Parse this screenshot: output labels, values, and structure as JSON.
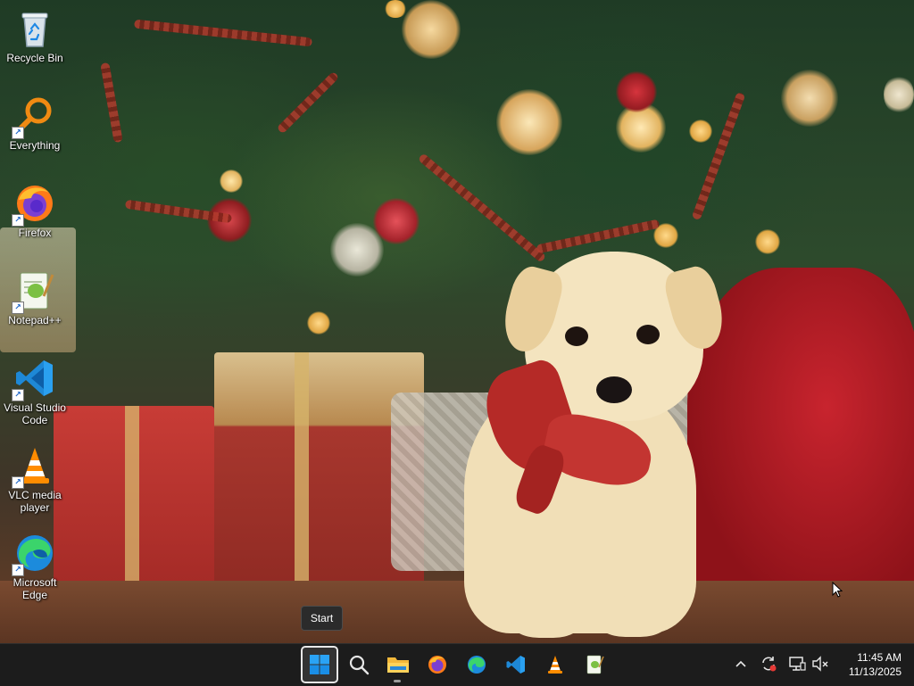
{
  "desktop": {
    "icons": [
      {
        "label": "Recycle Bin",
        "icon": "recycle-bin-icon"
      },
      {
        "label": "Everything",
        "icon": "everything-search-icon"
      },
      {
        "label": "Firefox",
        "icon": "firefox-icon"
      },
      {
        "label": "Notepad++",
        "icon": "notepad-plus-plus-icon"
      },
      {
        "label": "Visual Studio Code",
        "icon": "vscode-icon"
      },
      {
        "label": "VLC media player",
        "icon": "vlc-icon"
      },
      {
        "label": "Microsoft Edge",
        "icon": "edge-icon"
      }
    ]
  },
  "tooltip": {
    "text": "Start"
  },
  "taskbar": {
    "apps": [
      {
        "name": "Start",
        "icon": "windows-start-icon"
      },
      {
        "name": "Search",
        "icon": "search-icon"
      },
      {
        "name": "File Explorer",
        "icon": "file-explorer-icon"
      },
      {
        "name": "Firefox",
        "icon": "firefox-icon"
      },
      {
        "name": "Microsoft Edge",
        "icon": "edge-icon"
      },
      {
        "name": "Visual Studio Code",
        "icon": "vscode-icon"
      },
      {
        "name": "VLC media player",
        "icon": "vlc-icon"
      },
      {
        "name": "Notepad++",
        "icon": "notepad-plus-plus-icon"
      }
    ],
    "tray": {
      "icons": [
        "chevron-up-icon",
        "sync-icon",
        "network-icon",
        "volume-muted-icon"
      ]
    },
    "clock": {
      "time": "11:45 AM",
      "date": "11/13/2025"
    }
  },
  "colors": {
    "taskbar_bg": "#1c1c1c",
    "accent_blue": "#0a6fd6",
    "wallpaper_red": "#b52a27"
  }
}
